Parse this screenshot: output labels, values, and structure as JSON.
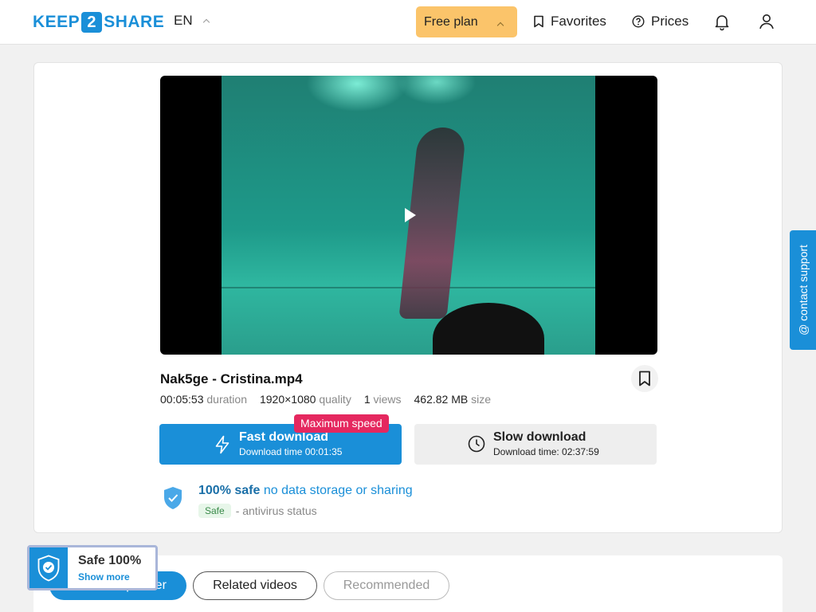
{
  "header": {
    "logo_left": "KEEP",
    "logo_mid": "2",
    "logo_right": "SHARE",
    "language": "EN",
    "plan_label": "Free plan",
    "favorites_label": "Favorites",
    "prices_label": "Prices"
  },
  "file": {
    "title": "Nak5ge - Cristina.mp4",
    "duration_value": "00:05:53",
    "duration_label": "duration",
    "quality_value": "1920×1080",
    "quality_label": "quality",
    "views_value": "1",
    "views_label": "views",
    "size_value": "462.82 MB",
    "size_label": "size"
  },
  "download": {
    "fast_title": "Fast download",
    "fast_time": "Download time 00:01:35",
    "speed_badge": "Maximum speed",
    "slow_title": "Slow download",
    "slow_time": "Download time: 02:37:59"
  },
  "safety": {
    "strong": "100% safe",
    "light": "no data storage or sharing",
    "chip": "Safe",
    "status": "- antivirus status"
  },
  "support_label": "@ contact support",
  "tabs": {
    "partner": "From this partner",
    "related": "Related videos",
    "recommended": "Recommended"
  },
  "safe_badge": {
    "title": "Safe 100%",
    "link": "Show more"
  },
  "colors": {
    "brand_blue": "#1a8fd8",
    "plan_yellow": "#fbc46a",
    "badge_red": "#e5285f"
  }
}
